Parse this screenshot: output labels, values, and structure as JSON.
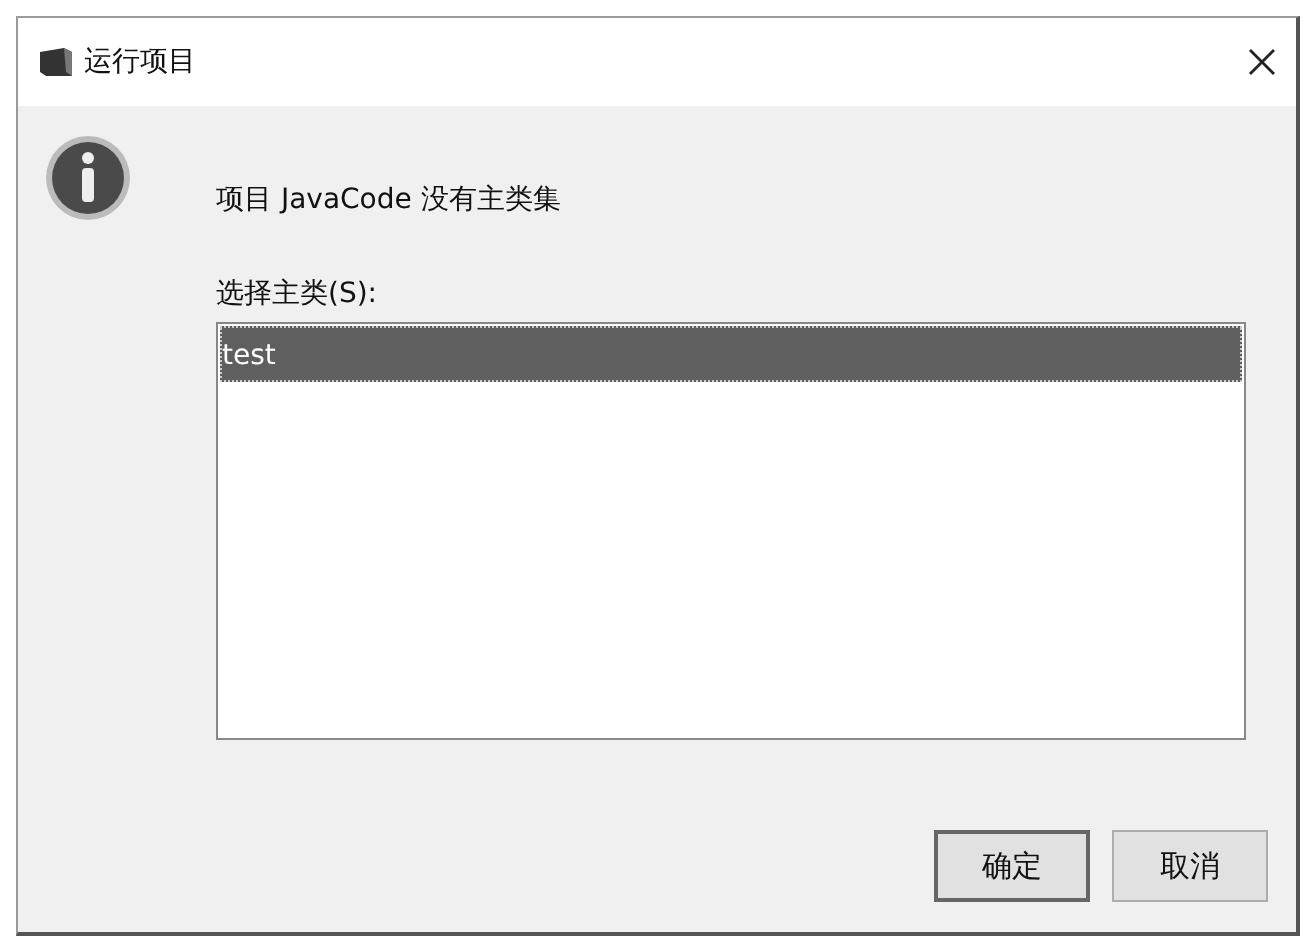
{
  "window": {
    "title": "运行项目"
  },
  "message": "项目 JavaCode 没有主类集",
  "list": {
    "label": "选择主类(S):",
    "items": [
      {
        "label": "test",
        "selected": true
      }
    ]
  },
  "buttons": [
    {
      "label": "确定",
      "default": true
    },
    {
      "label": "取消",
      "default": false
    }
  ]
}
